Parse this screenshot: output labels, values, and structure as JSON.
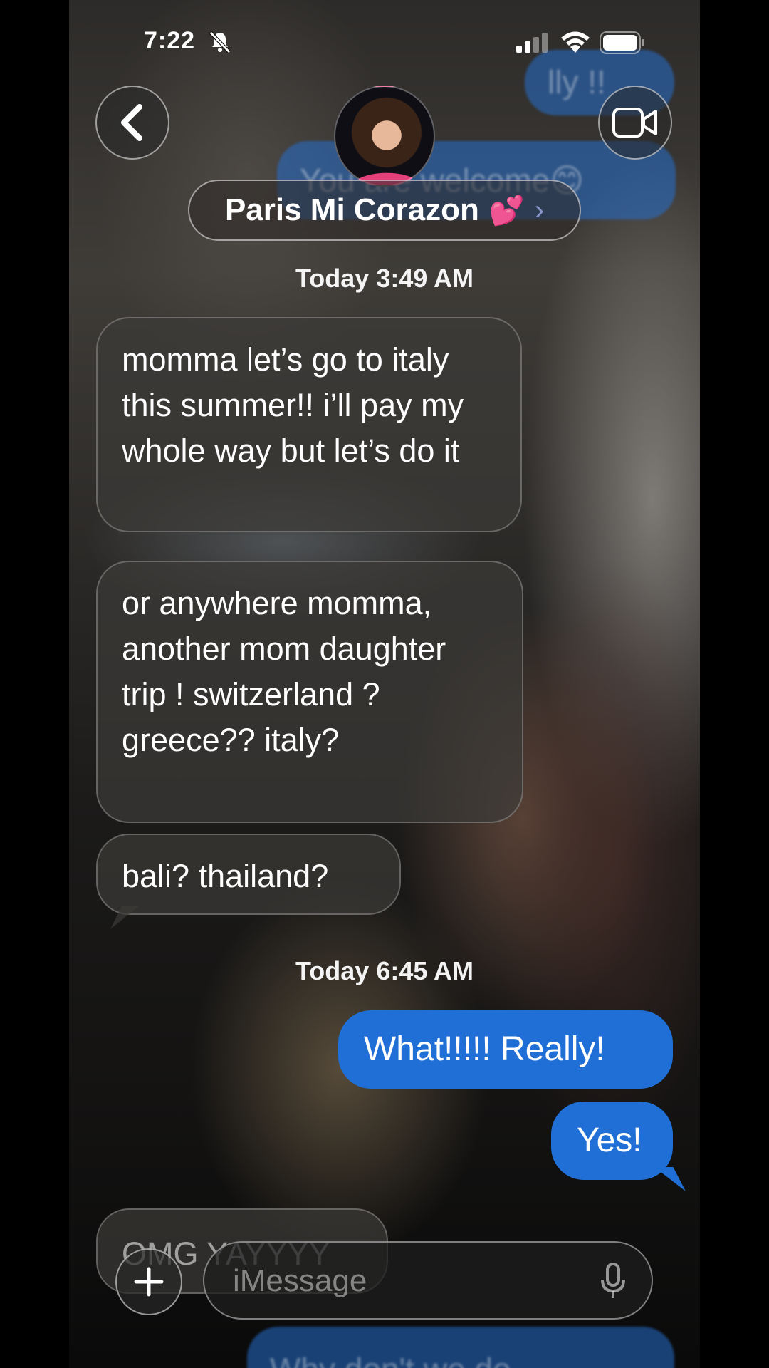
{
  "status_bar": {
    "time": "7:22"
  },
  "header": {
    "contact_name": "Paris Mi Corazon",
    "contact_emoji": "💕",
    "chevron": "›"
  },
  "ghost_messages": {
    "top_a": "lly !!",
    "top_b": "You are welcome",
    "top_b_emoji": "😊",
    "bottom": "Why don't we do"
  },
  "messages": {
    "timestamp_1": "Today 3:49 AM",
    "in_1": "momma let’s go to italy this summer!! i’ll pay my whole way but let’s do it",
    "in_2": "or anywhere momma, another mom daughter trip ! switzerland ? greece?? italy?",
    "in_3": "bali? thailand?",
    "timestamp_2": "Today 6:45 AM",
    "out_1": "What!!!!! Really!",
    "out_2": "Yes!",
    "in_4_partial": "OMG YAYYYY"
  },
  "composer": {
    "placeholder": "iMessage"
  },
  "colors": {
    "sent_bubble": "#1f6fd6",
    "received_bubble": "#3c3a38"
  },
  "icons": {
    "back": "back-chevron-icon",
    "video": "video-camera-icon",
    "plus": "plus-icon",
    "mic": "microphone-icon"
  }
}
